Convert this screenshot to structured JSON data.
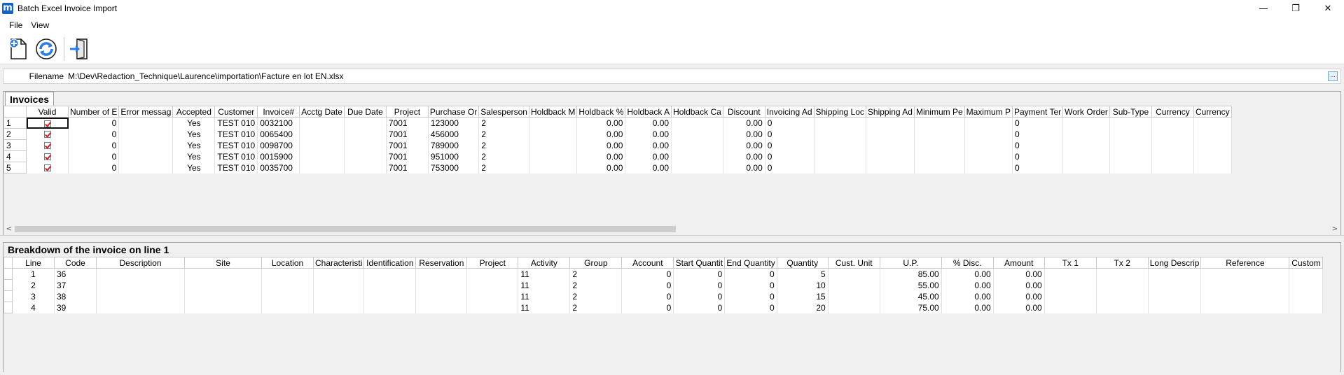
{
  "window": {
    "title": "Batch Excel Invoice Import",
    "app_icon_letter": "m",
    "controls": {
      "minimize": "—",
      "restore": "❐",
      "close": "✕"
    }
  },
  "menu": {
    "items": [
      "File",
      "View"
    ]
  },
  "toolbar": {
    "buttons": [
      "new-document-icon",
      "refresh-icon",
      "exit-door-icon"
    ]
  },
  "file": {
    "label": "Filename",
    "value": "M:\\Dev\\Redaction_Technique\\Laurence\\importation\\Facture en lot EN.xlsx",
    "browse": "..."
  },
  "invoices": {
    "title": "Invoices",
    "columns": [
      "Valid",
      "Number of E",
      "Error messag",
      "Accepted",
      "Customer",
      "Invoice#",
      "Acctg Date",
      "Due Date",
      "Project",
      "Purchase Or",
      "Salesperson",
      "Holdback M",
      "Holdback %",
      "Holdback A",
      "Holdback Ca",
      "Discount",
      "Invoicing Ad",
      "Shipping Loc",
      "Shipping Ad",
      "Minimum Pe",
      "Maximum P",
      "Payment Ter",
      "Work Order",
      "Sub-Type",
      "Currency",
      "Currency"
    ],
    "rows": [
      {
        "n": "1",
        "errors": "0",
        "accepted": "Yes",
        "customer": "TEST 010",
        "invoice": "0032100",
        "project": "7001",
        "po": "123000",
        "sales": "2",
        "hpct": "0.00",
        "hamt": "0.00",
        "disc": "0.00",
        "inv_ad": "0",
        "pay": "0"
      },
      {
        "n": "2",
        "errors": "0",
        "accepted": "Yes",
        "customer": "TEST 010",
        "invoice": "0065400",
        "project": "7001",
        "po": "456000",
        "sales": "2",
        "hpct": "0.00",
        "hamt": "0.00",
        "disc": "0.00",
        "inv_ad": "0",
        "pay": "0"
      },
      {
        "n": "3",
        "errors": "0",
        "accepted": "Yes",
        "customer": "TEST 010",
        "invoice": "0098700",
        "project": "7001",
        "po": "789000",
        "sales": "2",
        "hpct": "0.00",
        "hamt": "0.00",
        "disc": "0.00",
        "inv_ad": "0",
        "pay": "0"
      },
      {
        "n": "4",
        "errors": "0",
        "accepted": "Yes",
        "customer": "TEST 010",
        "invoice": "0015900",
        "project": "7001",
        "po": "951000",
        "sales": "2",
        "hpct": "0.00",
        "hamt": "0.00",
        "disc": "0.00",
        "inv_ad": "0",
        "pay": "0"
      },
      {
        "n": "5",
        "errors": "0",
        "accepted": "Yes",
        "customer": "TEST 010",
        "invoice": "0035700",
        "project": "7001",
        "po": "753000",
        "sales": "2",
        "hpct": "0.00",
        "hamt": "0.00",
        "disc": "0.00",
        "inv_ad": "0",
        "pay": "0"
      }
    ]
  },
  "breakdown": {
    "title": "Breakdown of the invoice on line 1",
    "columns": [
      "Line",
      "Code",
      "Description",
      "Site",
      "Location",
      "Characteristi",
      "Identification",
      "Reservation",
      "Project",
      "Activity",
      "Group",
      "Account",
      "Start Quantit",
      "End Quantity",
      "Quantity",
      "Cust. Unit",
      "U.P.",
      "% Disc.",
      "Amount",
      "Tx 1",
      "Tx 2",
      "Long Descrip",
      "Reference",
      "Custom"
    ],
    "rows": [
      {
        "line": "1",
        "code": "36",
        "activity": "11",
        "group": "2",
        "account": "0",
        "start": "0",
        "end": "0",
        "qty": "5",
        "up": "85.00",
        "disc": "0.00",
        "amount": "0.00"
      },
      {
        "line": "2",
        "code": "37",
        "activity": "11",
        "group": "2",
        "account": "0",
        "start": "0",
        "end": "0",
        "qty": "10",
        "up": "55.00",
        "disc": "0.00",
        "amount": "0.00"
      },
      {
        "line": "3",
        "code": "38",
        "activity": "11",
        "group": "2",
        "account": "0",
        "start": "0",
        "end": "0",
        "qty": "15",
        "up": "45.00",
        "disc": "0.00",
        "amount": "0.00"
      },
      {
        "line": "4",
        "code": "39",
        "activity": "11",
        "group": "2",
        "account": "0",
        "start": "0",
        "end": "0",
        "qty": "20",
        "up": "75.00",
        "disc": "0.00",
        "amount": "0.00"
      }
    ]
  },
  "scroll": {
    "left": "<",
    "right": ">"
  }
}
